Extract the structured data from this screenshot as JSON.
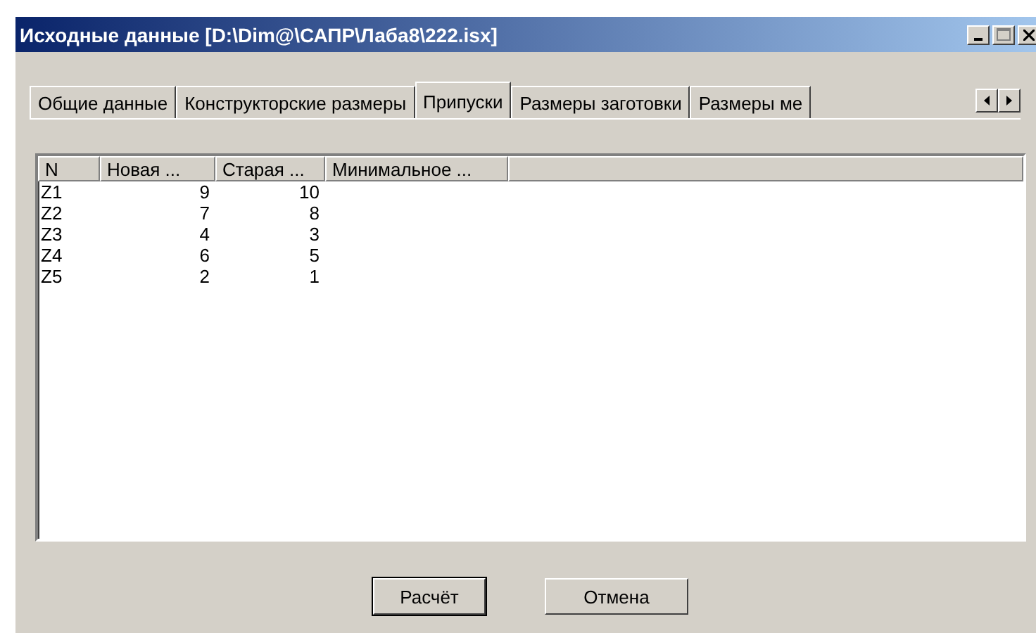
{
  "window": {
    "title": "Исходные данные [D:\\Dim@\\САПР\\Лаба8\\222.isx]"
  },
  "tabs": [
    {
      "label": "Общие данные",
      "selected": false
    },
    {
      "label": "Конструкторские размеры",
      "selected": false
    },
    {
      "label": "Припуски",
      "selected": true
    },
    {
      "label": "Размеры заготовки",
      "selected": false
    },
    {
      "label": "Размеры ме",
      "selected": false
    }
  ],
  "table": {
    "columns": [
      {
        "label": "N"
      },
      {
        "label": "Новая ..."
      },
      {
        "label": "Старая ..."
      },
      {
        "label": "Минимальное ..."
      }
    ],
    "rows": [
      [
        "Z1",
        "9",
        "10"
      ],
      [
        "Z2",
        "7",
        "8"
      ],
      [
        "Z3",
        "4",
        "3"
      ],
      [
        "Z4",
        "6",
        "5"
      ],
      [
        "Z5",
        "2",
        "1"
      ]
    ]
  },
  "buttons": [
    {
      "label": "Расчёт",
      "default": true
    },
    {
      "label": "Отмена",
      "default": false
    }
  ]
}
